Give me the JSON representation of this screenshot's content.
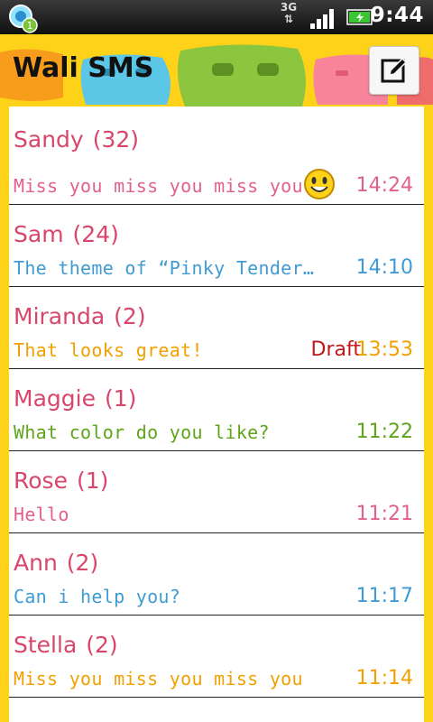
{
  "status_bar": {
    "network": "3G",
    "time": "9:44",
    "notification_count": "1"
  },
  "header": {
    "title": "Wali SMS",
    "compose_icon": "compose-icon"
  },
  "conversations": [
    {
      "name": "Sandy",
      "count": "(32)",
      "snippet": "Miss you miss you miss you",
      "time": "14:24",
      "color": "#e0628a",
      "has_emoji": true
    },
    {
      "name": "Sam",
      "count": "(24)",
      "snippet": "The theme of  “Pinky Tender…",
      "time": "14:10",
      "color": "#3f9bd4"
    },
    {
      "name": "Miranda",
      "count": "(2)",
      "snippet": "That looks great!",
      "draft": "Draft",
      "time": "13:53",
      "color": "#f0a000"
    },
    {
      "name": "Maggie",
      "count": "(1)",
      "snippet": "What color do you like?",
      "time": "11:22",
      "color": "#5fa51c"
    },
    {
      "name": "Rose",
      "count": "(1)",
      "snippet": "Hello",
      "time": "11:21",
      "color": "#e0628a"
    },
    {
      "name": "Ann",
      "count": "(2)",
      "snippet": "Can i help you?",
      "time": "11:17",
      "color": "#3f9bd4"
    },
    {
      "name": "Stella",
      "count": "(2)",
      "snippet": "Miss you miss you miss you",
      "time": "11:14",
      "color": "#f0a000"
    }
  ],
  "colors": {
    "background": "#ffd21a",
    "name": "#d8466b",
    "draft": "#c0181a"
  }
}
